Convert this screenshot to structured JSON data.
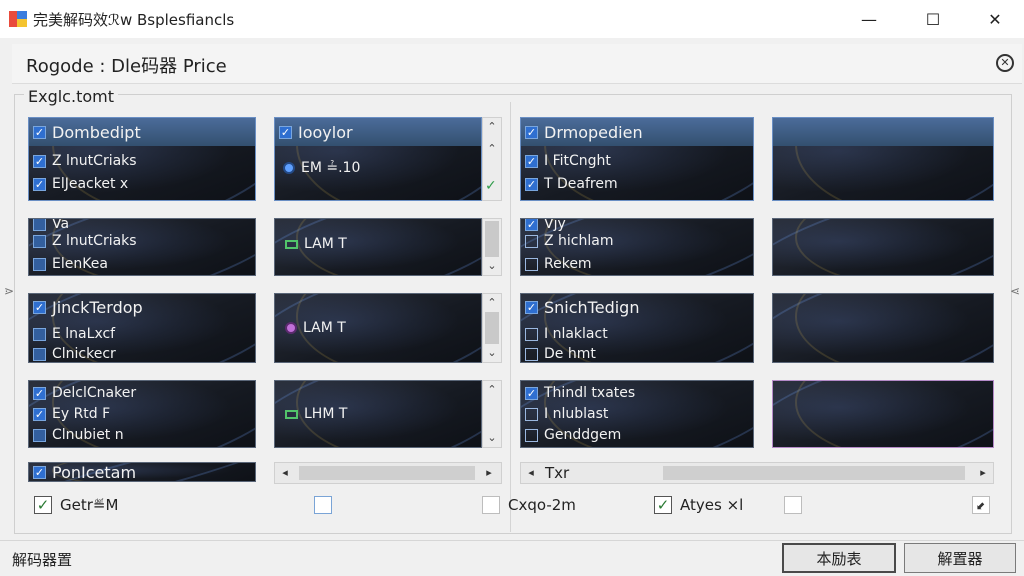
{
  "window": {
    "title": "完美解码效ℛw Bsplesfiancls",
    "min_glyph": "—",
    "max_glyph": "☐",
    "close_glyph": "✕"
  },
  "panel": {
    "title": "Rogode : Dle码器 Price",
    "close_glyph": "⊗"
  },
  "group": {
    "legend": "Exglc.tomt"
  },
  "tiles": {
    "a1": {
      "items": [
        "Dombedipt",
        "Z lnutCriaks",
        "ElJeacket x"
      ]
    },
    "a2": {
      "items": [
        "Va",
        "Z lnutCriaks",
        "ElenKea"
      ]
    },
    "a3": {
      "items": [
        "JinckTerdop",
        "E lnaLxcf",
        "Clnickecr"
      ]
    },
    "a4": {
      "items": [
        "DelclCnaker",
        "Ey Rtd F",
        "Clnubiet n"
      ]
    },
    "a5": {
      "items": [
        "PonIcetam"
      ]
    },
    "b1": {
      "header": "Iooylor",
      "item": "EM ≟.10"
    },
    "b2": {
      "item": "LAM T"
    },
    "b3": {
      "item": "LAM T"
    },
    "b4": {
      "item": "LHM T"
    },
    "c1": {
      "items": [
        "Drmopedien",
        "I FitCnght",
        "T Deafrem"
      ]
    },
    "c2": {
      "items": [
        "Vjy",
        "Z hichlam",
        "Rekem"
      ]
    },
    "c3": {
      "items": [
        "SnichTedign",
        "I nlaklact",
        "De hmt"
      ]
    },
    "c4": {
      "items": [
        "Thindl txates",
        "I nlublast",
        "Genddgem"
      ]
    }
  },
  "scroll": {
    "up_glyph": "⌃",
    "down_glyph": "⌄",
    "left_glyph": "◂",
    "right_glyph": "▸",
    "ok_glyph": "✓",
    "hlabel": "Txr"
  },
  "edge": {
    "left": "⋗",
    "right": "⋖"
  },
  "options": {
    "left_label": "Getr≝M",
    "mid_label": "Cxqo-2m",
    "right_label": "Atyes ⨯l",
    "check_glyph": "✓",
    "resize_glyph": "⬋"
  },
  "status": {
    "text": "解码器置",
    "btn1": "本励表",
    "btn2": "解置器"
  }
}
